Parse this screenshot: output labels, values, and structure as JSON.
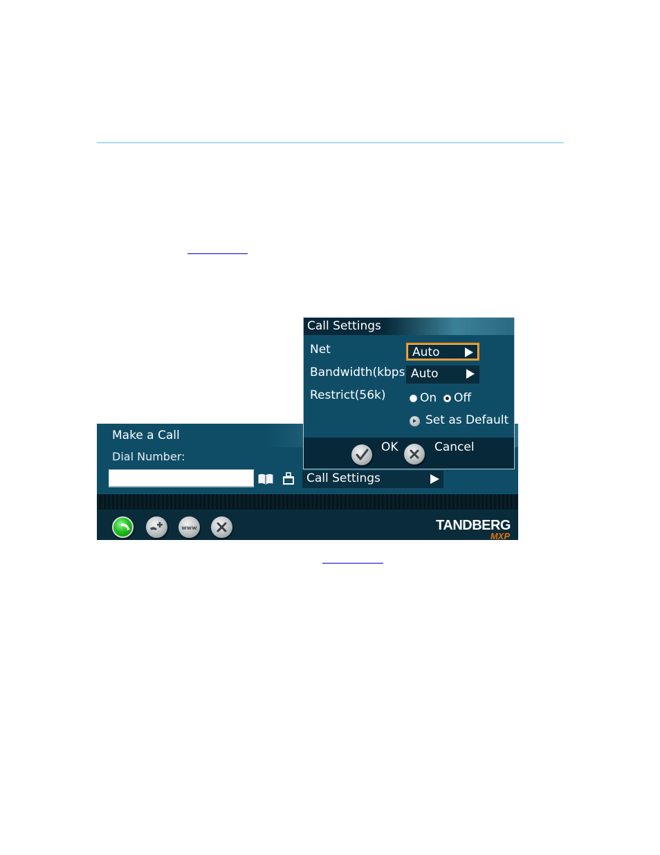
{
  "document": {
    "links": [
      {
        "label": ""
      },
      {
        "label": ""
      }
    ]
  },
  "screen": {
    "title": "Make a Call",
    "dial_label": "Dial Number:",
    "dial_input": {
      "value": "",
      "placeholder": ""
    },
    "icons": [
      "phonebook-icon",
      "briefcase-icon"
    ],
    "call_settings_item": {
      "label": "Call Settings",
      "icon": "right-arrow-icon"
    },
    "bottom_buttons": [
      {
        "name": "dial-button",
        "icon": "phone-icon",
        "color": "#1ec21b"
      },
      {
        "name": "add-call-button",
        "icon": "add-call-icon"
      },
      {
        "name": "web-button",
        "icon": "www-icon"
      },
      {
        "name": "close-button",
        "icon": "close-icon"
      }
    ],
    "logo": {
      "brand": "TANDBERG",
      "sub": "MXP",
      "sub_color": "#e2730f"
    }
  },
  "dialog": {
    "title": "Call Settings",
    "rows": [
      {
        "label": "Net",
        "value": "Auto",
        "focused": true
      },
      {
        "label": "Bandwidth(kbps)",
        "value": "Auto",
        "focused": false
      }
    ],
    "restrict": {
      "label": "Restrict(56k)",
      "options": [
        {
          "label": "On",
          "checked": false
        },
        {
          "label": "Off",
          "checked": true
        }
      ]
    },
    "set_default_label": "Set as Default",
    "ok_label": "OK",
    "cancel_label": "Cancel",
    "focus_color": "#f08c1a"
  },
  "colors": {
    "panel": "#0f4d67",
    "panel_dark": "#072838",
    "rule": "#acdce8",
    "link": "#0000cc"
  }
}
